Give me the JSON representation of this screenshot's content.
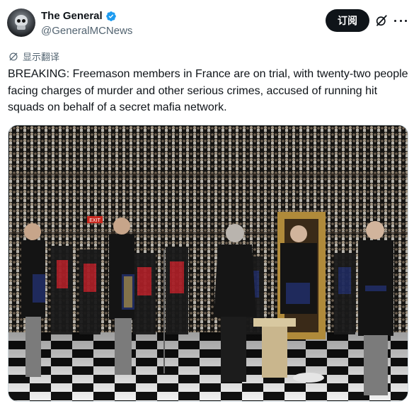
{
  "author": {
    "display_name": "The General",
    "handle": "@GeneralMCNews",
    "verified": true,
    "avatar_icon": "skull-avatar-icon"
  },
  "actions": {
    "subscribe_label": "订阅",
    "grok_icon": "grok-slash-icon",
    "more_icon": "more-dots-icon"
  },
  "translate": {
    "label": "显示翻译",
    "icon": "translate-icon"
  },
  "tweet": {
    "text": "BREAKING: Freemason members in France are on trial, with twenty-two people facing charges of murder and other serious crimes, accused of running hit squads on behalf of a secret mafia network."
  },
  "media": {
    "type": "photo",
    "sign_text": "EXIT"
  },
  "colors": {
    "accent_verified": "#1d9bf0",
    "text_primary": "#0f1419",
    "text_secondary": "#536471",
    "button_bg": "#0f1419"
  }
}
